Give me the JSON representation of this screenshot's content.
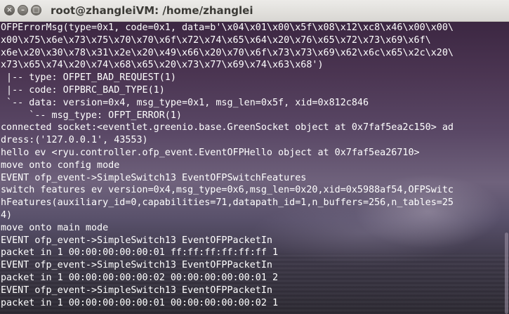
{
  "window": {
    "title": "root@zhangleiVM: /home/zhanglei",
    "close_glyph": "×",
    "minimize_glyph": "–",
    "maximize_glyph": "□"
  },
  "terminal": {
    "lines": [
      "OFPErrorMsg(type=0x1, code=0x1, data=b'\\x04\\x01\\x00\\x5f\\x08\\x12\\xc8\\x46\\x00\\x00\\",
      "x00\\x75\\x6e\\x73\\x75\\x70\\x70\\x6f\\x72\\x74\\x65\\x64\\x20\\x76\\x65\\x72\\x73\\x69\\x6f\\",
      "x6e\\x20\\x30\\x78\\x31\\x2e\\x20\\x49\\x66\\x20\\x70\\x6f\\x73\\x73\\x69\\x62\\x6c\\x65\\x2c\\x20\\",
      "x73\\x65\\x74\\x20\\x74\\x68\\x65\\x20\\x73\\x77\\x69\\x74\\x63\\x68')",
      " |-- type: OFPET_BAD_REQUEST(1)",
      " |-- code: OFPBRC_BAD_TYPE(1)",
      " `-- data: version=0x4, msg_type=0x1, msg_len=0x5f, xid=0x812c846",
      "     `-- msg_type: OFPT_ERROR(1)",
      "connected socket:<eventlet.greenio.base.GreenSocket object at 0x7faf5ea2c150> ad",
      "dress:('127.0.0.1', 43553)",
      "hello ev <ryu.controller.ofp_event.EventOFPHello object at 0x7faf5ea26710>",
      "move onto config mode",
      "EVENT ofp_event->SimpleSwitch13 EventOFPSwitchFeatures",
      "switch features ev version=0x4,msg_type=0x6,msg_len=0x20,xid=0x5988af54,OFPSwitc",
      "hFeatures(auxiliary_id=0,capabilities=71,datapath_id=1,n_buffers=256,n_tables=25",
      "4)",
      "move onto main mode",
      "EVENT ofp_event->SimpleSwitch13 EventOFPPacketIn",
      "packet in 1 00:00:00:00:00:01 ff:ff:ff:ff:ff:ff 1",
      "EVENT ofp_event->SimpleSwitch13 EventOFPPacketIn",
      "packet in 1 00:00:00:00:00:02 00:00:00:00:00:01 2",
      "EVENT ofp_event->SimpleSwitch13 EventOFPPacketIn",
      "packet in 1 00:00:00:00:00:01 00:00:00:00:00:02 1"
    ]
  }
}
